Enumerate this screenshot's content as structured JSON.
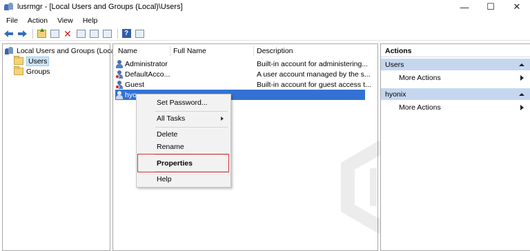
{
  "window": {
    "title": "lusrmgr - [Local Users and Groups (Local)\\Users]",
    "minimize_glyph": "—",
    "maximize_glyph": "☐",
    "close_glyph": "✕"
  },
  "menu": [
    "File",
    "Action",
    "View",
    "Help"
  ],
  "toolbar": {
    "icons": [
      "back-arrow-icon",
      "forward-arrow-icon",
      "up-folder-icon",
      "show-hide-tree-icon",
      "delete-icon",
      "properties-icon",
      "refresh-icon",
      "export-icon",
      "help-icon",
      "console-view-icon"
    ],
    "help_glyph": "?"
  },
  "tree": {
    "root": "Local Users and Groups (Local)",
    "items": [
      "Users",
      "Groups"
    ]
  },
  "list": {
    "columns": [
      "Name",
      "Full Name",
      "Description"
    ],
    "rows": [
      {
        "name": "Administrator",
        "full_name": "",
        "description": "Built-in account for administering..."
      },
      {
        "name": "DefaultAcco...",
        "full_name": "",
        "description": "A user account managed by the s..."
      },
      {
        "name": "Guest",
        "full_name": "",
        "description": "Built-in account for guest access t..."
      },
      {
        "name": "hyo",
        "full_name": "",
        "description": ""
      }
    ]
  },
  "context_menu": {
    "items": [
      "Set Password...",
      "All Tasks",
      "Delete",
      "Rename",
      "Properties",
      "Help"
    ]
  },
  "actions": {
    "title": "Actions",
    "groups": [
      {
        "label": "Users",
        "item": "More Actions"
      },
      {
        "label": "hyonix",
        "item": "More Actions"
      }
    ]
  },
  "colors": {
    "selection": "#3372d4",
    "action_group_bg": "#c5d7ef",
    "highlight_border": "#d93030"
  }
}
